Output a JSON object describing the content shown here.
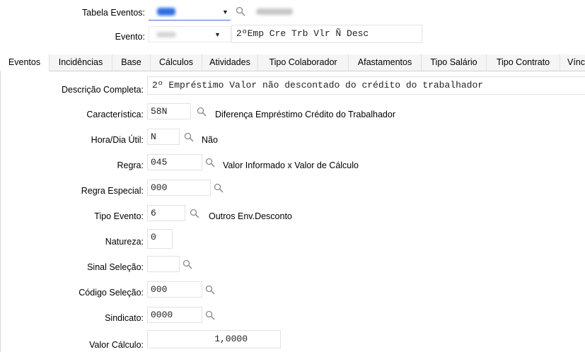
{
  "header": {
    "tabela_eventos_label": "Tabela Eventos:",
    "evento_label": "Evento:",
    "evento_desc": "2ºEmp Cre Trb Vlr Ñ Desc"
  },
  "tabs": [
    {
      "label": "Eventos",
      "active": true
    },
    {
      "label": "Incidências"
    },
    {
      "label": "Base"
    },
    {
      "label": "Cálculos"
    },
    {
      "label": "Atividades"
    },
    {
      "label": "Tipo Colaborador"
    },
    {
      "label": "Afastamentos"
    },
    {
      "label": "Tipo Salário"
    },
    {
      "label": "Tipo Contrato"
    },
    {
      "label": "Vínc"
    }
  ],
  "form": {
    "descricao": {
      "label": "Descrição Completa:",
      "value": "2º Empréstimo Valor não descontado do crédito do trabalhador"
    },
    "caracteristica": {
      "label": "Característica:",
      "value": "58N",
      "desc": "Diferença Empréstimo Crédito do Trabalhador"
    },
    "hora_dia": {
      "label": "Hora/Dia Útil:",
      "value": "N",
      "desc": "Não"
    },
    "regra": {
      "label": "Regra:",
      "value": "045",
      "desc": "Valor Informado x Valor de Cálculo"
    },
    "regra_especial": {
      "label": "Regra Especial:",
      "value": "000"
    },
    "tipo_evento": {
      "label": "Tipo Evento:",
      "value": "6",
      "desc": "Outros Env.Desconto"
    },
    "natureza": {
      "label": "Natureza:",
      "value": "0"
    },
    "sinal_selecao": {
      "label": "Sinal Seleção:",
      "value": ""
    },
    "codigo_selecao": {
      "label": "Código Seleção:",
      "value": "000"
    },
    "sindicato": {
      "label": "Sindicato:",
      "value": "0000"
    },
    "valor_calculo": {
      "label": "Valor Cálculo:",
      "value": "1,0000"
    }
  },
  "icons": {
    "search": "magnifier-icon",
    "dropdown": "dropdown-arrow-icon"
  },
  "colors": {
    "focus_underline": "#3b6fd1",
    "blurred_value": "#2f6fe0"
  }
}
